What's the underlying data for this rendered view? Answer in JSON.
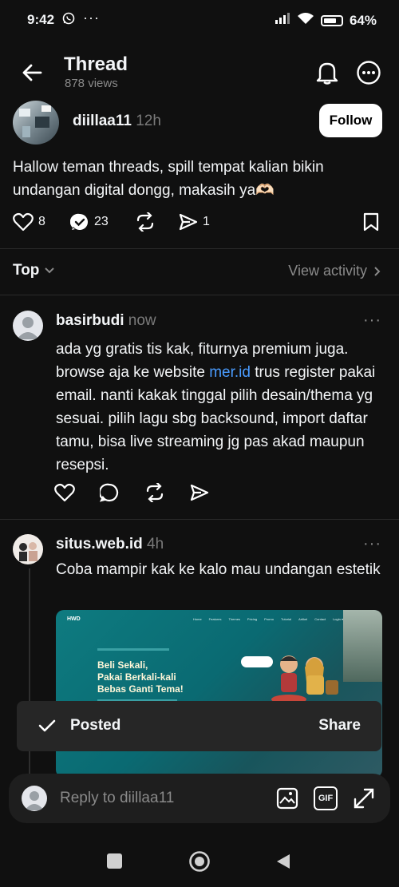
{
  "status": {
    "time": "9:42",
    "battery": "64%"
  },
  "header": {
    "title": "Thread",
    "views": "878 views"
  },
  "post": {
    "username": "diillaa11",
    "time": "12h",
    "follow_label": "Follow",
    "text": "Hallow teman threads, spill tempat kalian bikin undangan digital dongg, makasih ya🫶🏻",
    "likes": "8",
    "comments": "23",
    "shares": "1"
  },
  "sort": {
    "label": "Top",
    "view_activity": "View activity"
  },
  "replies": [
    {
      "username": "basirbudi",
      "time": "now",
      "text_before": "ada yg gratis tis kak, fiturnya premium juga. browse aja ke website ",
      "link": "mer.id",
      "text_after": " trus register pakai email. nanti kakak tinggal pilih desain/thema yg sesuai. pilih lagu sbg backsound, import daftar tamu, bisa live streaming jg pas akad maupun resepsi."
    },
    {
      "username": "situs.web.id",
      "time": "4h",
      "text": "Coba mampir kak ke  kalo mau undangan estetik"
    }
  ],
  "preview": {
    "logo": "HWD",
    "nav": [
      "Home",
      "Features",
      "Themes",
      "Pricing",
      "Promo",
      "Tutorial",
      "Artikel",
      "Contact",
      "Login ▾"
    ],
    "headline_1": "Beli Sekali,",
    "headline_2": "Pakai Berkali-kali",
    "headline_3": "Bebas Ganti Tema!"
  },
  "toast": {
    "label": "Posted",
    "action": "Share"
  },
  "reply_bar": {
    "placeholder": "Reply to diillaa11",
    "gif": "GIF"
  },
  "colors": {
    "background": "#101010",
    "link": "#4a9cff",
    "accent_card": "#0e7b80"
  }
}
